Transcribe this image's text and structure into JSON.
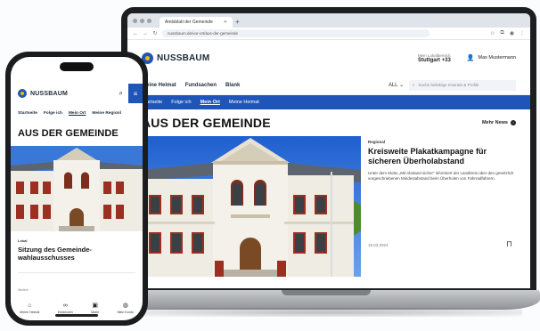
{
  "browser": {
    "tab_title": "Amtsblatt der Gemeinde",
    "url": "nussbaum.de/vor-ort/aus-der-gemeinde"
  },
  "desktop": {
    "logo": "NUSSBAUM",
    "location_label": "Mein Lokalbereich",
    "location_value": "Stuttgart +33",
    "user_name": "Max Mustermann",
    "nav": [
      "Meine Heimat",
      "Fundsachen",
      "Blank"
    ],
    "nav_select": "ALL",
    "search_placeholder": "Suche beliebige Inserate & Profile",
    "subnav": [
      "Startseite",
      "Folge ich",
      "Mein Ort",
      "Meine Heimat"
    ],
    "subnav_active": 2,
    "section_title": "AUS DER GEMEINDE",
    "more_label": "Mehr News",
    "feature": {
      "kicker": "Regional",
      "headline": "Kreisweite Plakatkampagne für sicheren Überholabstand",
      "teaser": "Unter dem Motto „Mit Abstand sicher“ informiert der Landkreis über den gesetzlich vorgeschriebenen Mindestabstand beim Überholen von Fahrradfahrern.",
      "date": "15.03.2024"
    }
  },
  "mobile": {
    "logo": "NUSSBAUM",
    "tabs": [
      "Startseite",
      "Folge ich",
      "Mein Ort",
      "Meine Regionl"
    ],
    "tabs_active": 2,
    "section_title": "AUS DER GEMEINDE",
    "kicker": "Lokal",
    "headline": "Sitzung des Gemeinde-wahlausschusses",
    "tiny_label": "Weitere",
    "bottom_nav": [
      {
        "label": "Meine Heimat",
        "icon": "home-icon"
      },
      {
        "label": "Entdecken",
        "icon": "binoculars-icon"
      },
      {
        "label": "Markt",
        "icon": "market-icon"
      },
      {
        "label": "Mein Konto",
        "icon": "account-icon"
      }
    ]
  },
  "colors": {
    "brand_blue": "#1f55b8",
    "logo_yellow": "#f2b51c",
    "sky": "#2e6fd6"
  }
}
